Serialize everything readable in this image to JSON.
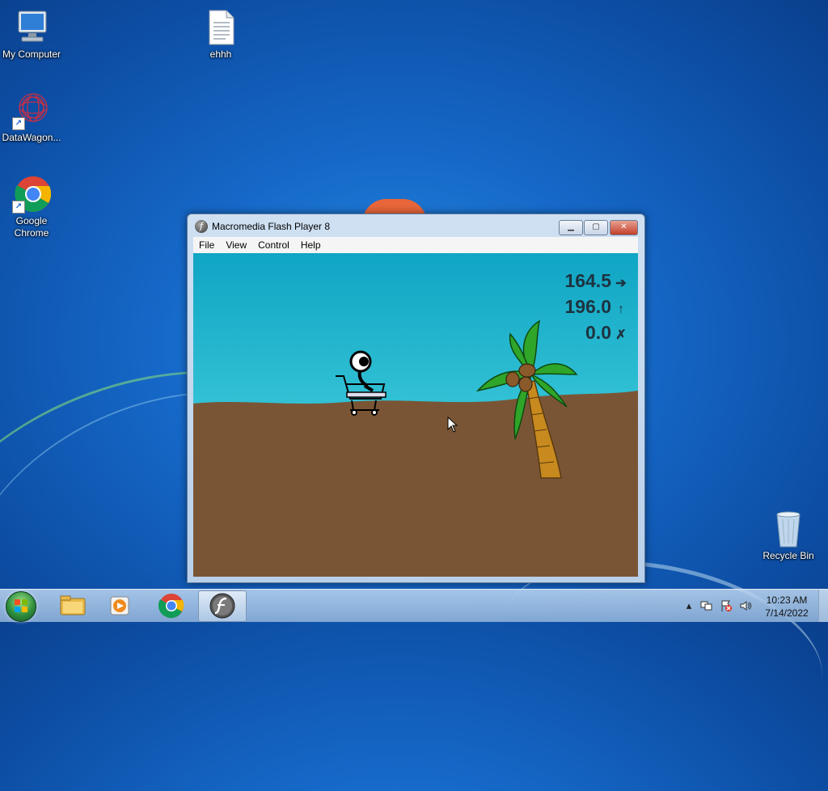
{
  "desktop": {
    "icons": [
      {
        "label": "My Computer",
        "icon": "computer-icon"
      },
      {
        "label": "ehhh",
        "icon": "text-file-icon"
      },
      {
        "label": "DataWagon...",
        "icon": "datawagon-icon"
      },
      {
        "label": "Google Chrome",
        "icon": "chrome-icon"
      },
      {
        "label": "Recycle Bin",
        "icon": "recycle-bin-icon"
      }
    ]
  },
  "window": {
    "title": "Macromedia Flash Player 8",
    "menu": [
      "File",
      "View",
      "Control",
      "Help"
    ],
    "hud": [
      {
        "value": "164.5",
        "icon": "arrow-right-icon"
      },
      {
        "value": "196.0",
        "icon": "arrow-up-icon"
      },
      {
        "value": "0.0",
        "icon": "crash-icon"
      }
    ]
  },
  "taskbar": {
    "pinned": [
      "explorer-icon",
      "media-player-icon",
      "chrome-icon",
      "flash-player-icon"
    ],
    "clock": {
      "time": "10:23 AM",
      "date": "7/14/2022"
    }
  },
  "colors": {
    "sky": "#31c0d4",
    "ground": "#7a5535",
    "palm_leaves": "#2fa52a",
    "trunk": "#c88a1e",
    "coconut": "#8a5a2b"
  }
}
